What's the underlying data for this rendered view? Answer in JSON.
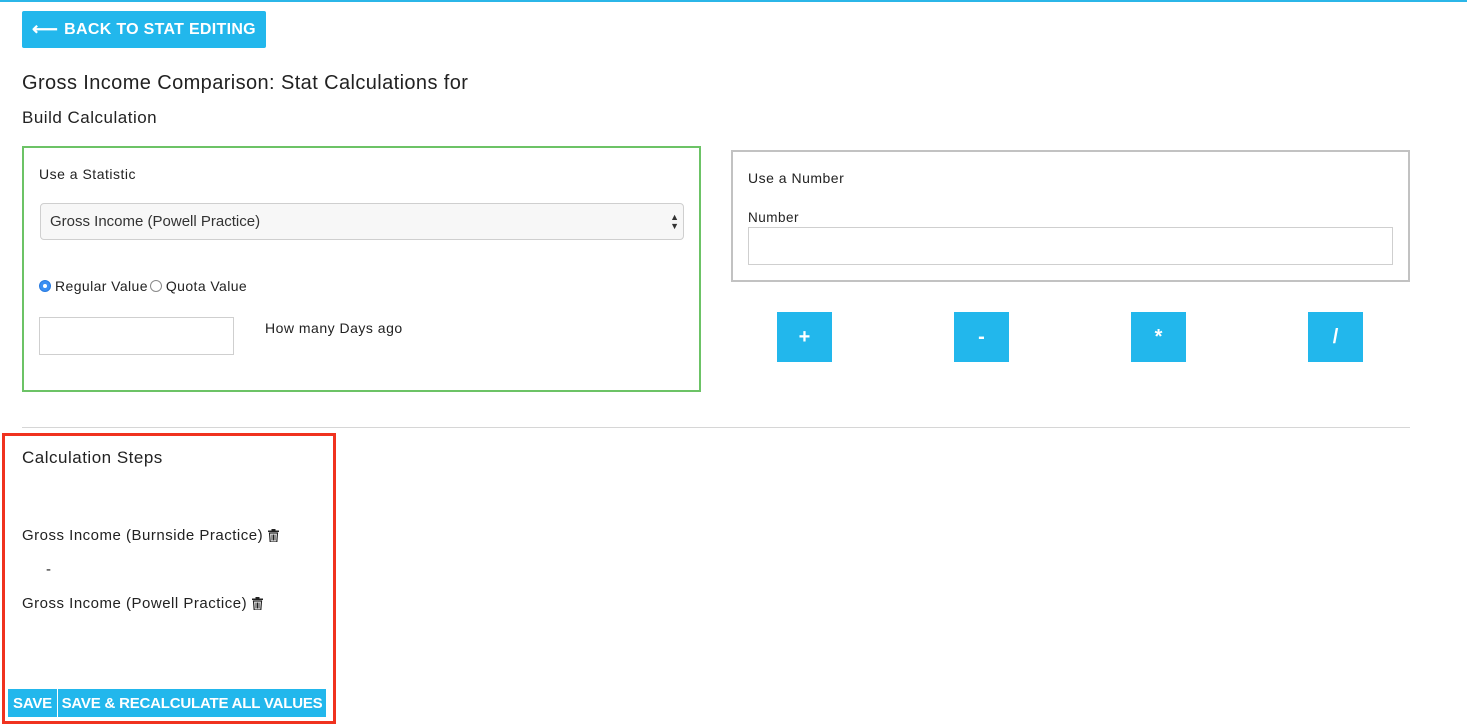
{
  "nav": {
    "back_label": "BACK TO STAT EDITING",
    "back_icon": "arrow-left-icon"
  },
  "page": {
    "title": "Gross Income Comparison: Stat Calculations for",
    "section_title": "Build Calculation"
  },
  "statistic_panel": {
    "heading": "Use a Statistic",
    "selected_statistic": "Gross Income (Powell Practice)",
    "value_type_options": [
      "Regular Value",
      "Quota Value"
    ],
    "selected_value_type": "Regular Value",
    "days_ago_value": "",
    "days_ago_label": "How many Days ago",
    "border_color": "#6cc366"
  },
  "number_panel": {
    "heading": "Use a Number",
    "field_label": "Number",
    "field_value": ""
  },
  "operators": [
    "+",
    "-",
    "*",
    "/"
  ],
  "steps": {
    "title": "Calculation Steps",
    "items": [
      {
        "label": "Gross Income (Burnside Practice)",
        "icon": "trash-icon"
      },
      {
        "operator": "-"
      },
      {
        "label": "Gross Income (Powell Practice)",
        "icon": "trash-icon"
      }
    ]
  },
  "actions": {
    "save_label": "SAVE",
    "save_recalc_label": "SAVE & RECALCULATE ALL VALUES"
  },
  "colors": {
    "accent": "#22b7ec",
    "highlight": "#f0321f"
  }
}
